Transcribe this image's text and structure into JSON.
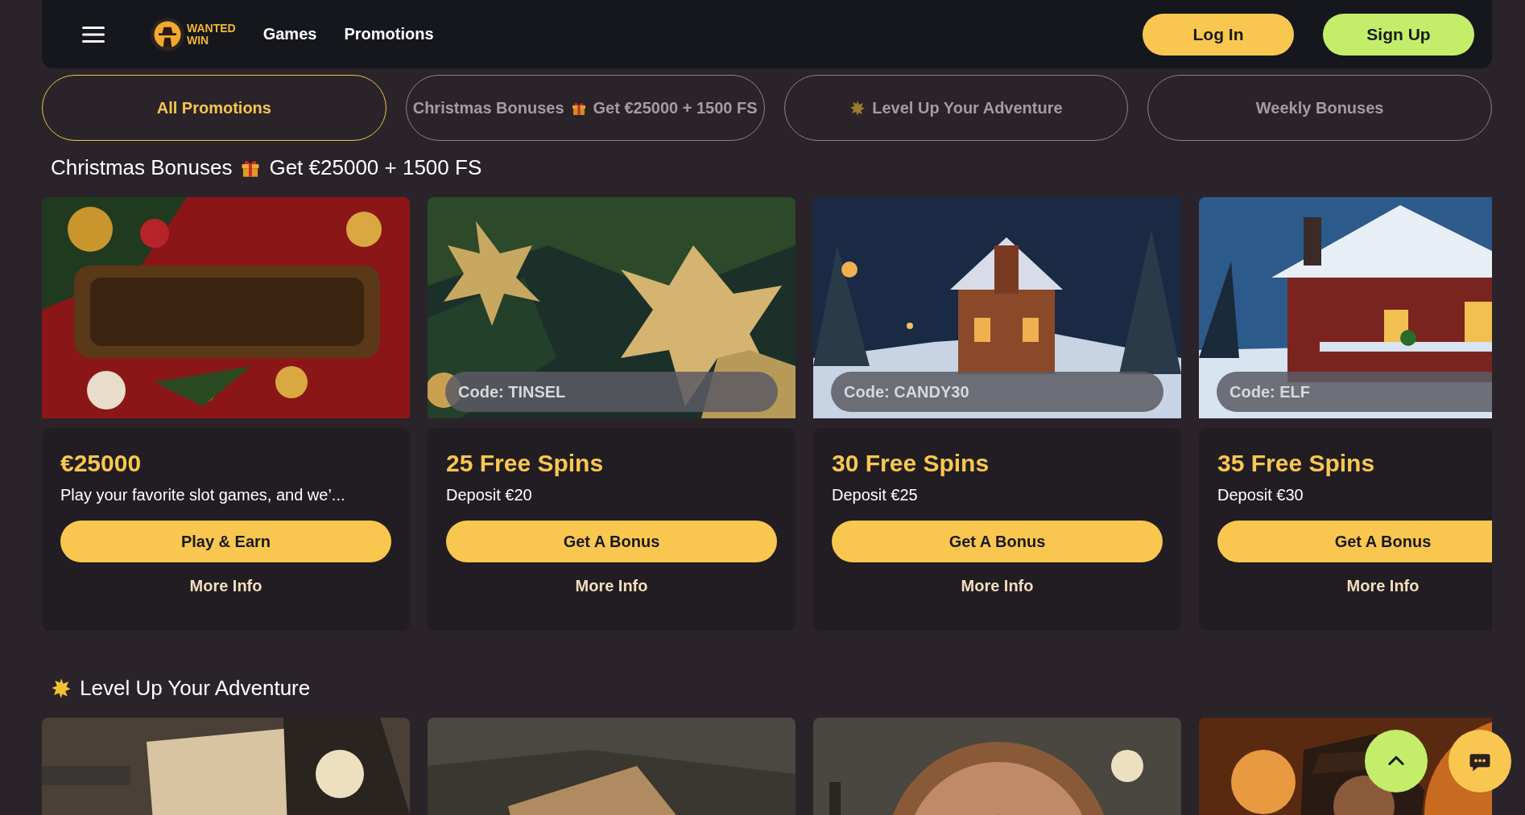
{
  "header": {
    "logo": {
      "line1": "WANTED",
      "line2": "WIN"
    },
    "nav": [
      {
        "label": "Games"
      },
      {
        "label": "Promotions"
      }
    ],
    "buttons": [
      {
        "kind": "login",
        "label": "Log In"
      },
      {
        "kind": "signup",
        "label": "Sign Up"
      }
    ]
  },
  "tabs": [
    {
      "label": "All Promotions",
      "selected": true
    },
    {
      "kind": "christmas",
      "prefix": "Christmas Bonuses",
      "label": "Get €25000 + 1500 FS",
      "selected": false
    },
    {
      "kind": "adventure",
      "label": "Level Up Your Adventure",
      "selected": false
    },
    {
      "label": "Weekly Bonuses",
      "selected": false
    }
  ],
  "sections": [
    {
      "kind": "christmas",
      "prefix": "Christmas Bonuses",
      "title": "Get €25000 + 1500 FS",
      "cards": [
        {
          "kind": "promo",
          "title": "€25000",
          "description": "Play your favorite slot games, and we’...",
          "button": "Play & Earn",
          "link": "More Info"
        },
        {
          "kind": "promo",
          "code": "Code: TINSEL",
          "title": "25 Free Spins",
          "description": "Deposit €20",
          "button": "Get A Bonus",
          "link": "More Info"
        },
        {
          "kind": "promo",
          "code": "Code: CANDY30",
          "title": "30 Free Spins",
          "description": "Deposit €25",
          "button": "Get A Bonus",
          "link": "More Info"
        },
        {
          "kind": "promo",
          "code": "Code: ELF",
          "title": "35 Free Spins",
          "description": "Deposit €30",
          "button": "Get A Bonus",
          "link": "More Info"
        }
      ]
    },
    {
      "kind": "adventure",
      "title": "Level Up Your Adventure"
    }
  ],
  "floating_buttons": [
    {
      "kind": "scroll_top"
    },
    {
      "kind": "chat"
    }
  ]
}
